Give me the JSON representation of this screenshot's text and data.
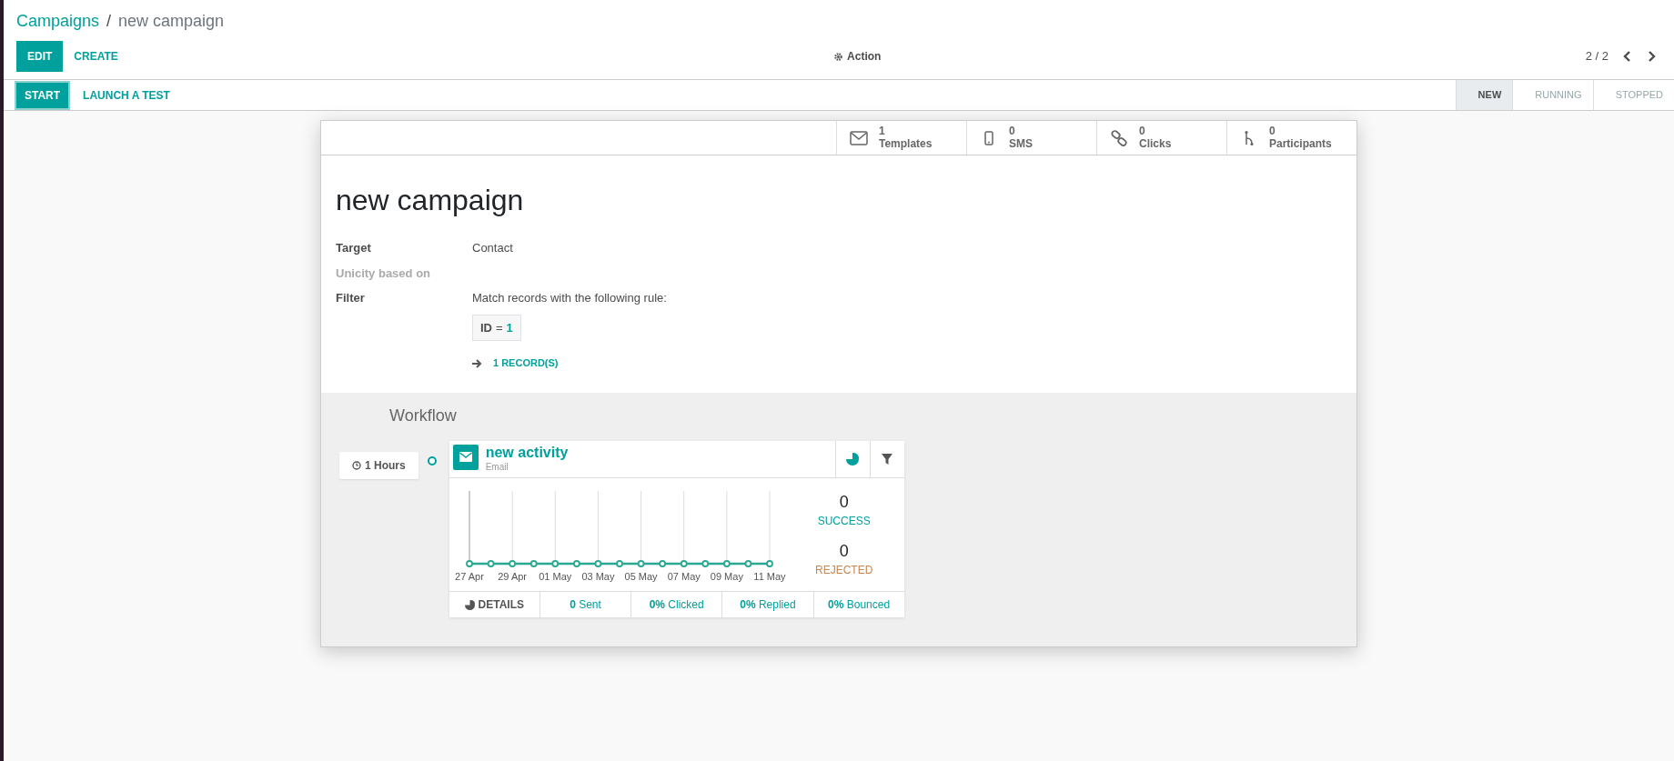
{
  "breadcrumb_separator": "/",
  "breadcrumb": [
    {
      "label": "Campaigns",
      "kind": "link"
    },
    {
      "label": "new campaign",
      "kind": "current"
    }
  ],
  "control_buttons": [
    {
      "label": "EDIT",
      "kind": "primary"
    },
    {
      "label": "CREATE",
      "kind": "link"
    }
  ],
  "action_menu": {
    "label": "Action"
  },
  "pager": {
    "value": "2 / 2"
  },
  "status_buttons": [
    {
      "label": "START",
      "kind": "primary"
    },
    {
      "label": "LAUNCH A TEST",
      "kind": "link"
    }
  ],
  "stages": [
    {
      "label": "NEW",
      "selected": true
    },
    {
      "label": "RUNNING",
      "selected": false
    },
    {
      "label": "STOPPED",
      "selected": false
    }
  ],
  "stat_buttons": [
    {
      "value": "1",
      "label": "Templates",
      "kind": "envelope"
    },
    {
      "value": "0",
      "label": "SMS",
      "kind": "phone"
    },
    {
      "value": "0",
      "label": "Clicks",
      "kind": "link"
    },
    {
      "value": "0",
      "label": "Participants",
      "kind": "fork"
    }
  ],
  "form": {
    "title": "new campaign",
    "fields": [
      {
        "label": "Target",
        "value": "Contact",
        "disabled": false
      },
      {
        "label": "Unicity based on",
        "disabled": true
      },
      {
        "label": "Filter",
        "value": "Match records with the following rule:",
        "disabled": false
      }
    ],
    "domain": {
      "field": "ID",
      "operator": "=",
      "value": "1"
    },
    "records_link": "1 RECORD(S)"
  },
  "workflow": {
    "title": "Workflow",
    "activities": [
      {
        "trigger": "1 Hours",
        "name": "new activity",
        "type": "Email",
        "x_labels": [
          "27 Apr",
          "29 Apr",
          "01 May",
          "03 May",
          "05 May",
          "07 May",
          "09 May",
          "11 May"
        ],
        "success": {
          "value": "0",
          "label": "SUCCESS"
        },
        "rejected": {
          "value": "0",
          "label": "REJECTED"
        },
        "details": "DETAILS",
        "stats": [
          {
            "value": "0",
            "label": "Sent"
          },
          {
            "value": "0%",
            "label": "Clicked"
          },
          {
            "value": "0%",
            "label": "Replied"
          },
          {
            "value": "0%",
            "label": "Bounced"
          }
        ]
      }
    ]
  }
}
